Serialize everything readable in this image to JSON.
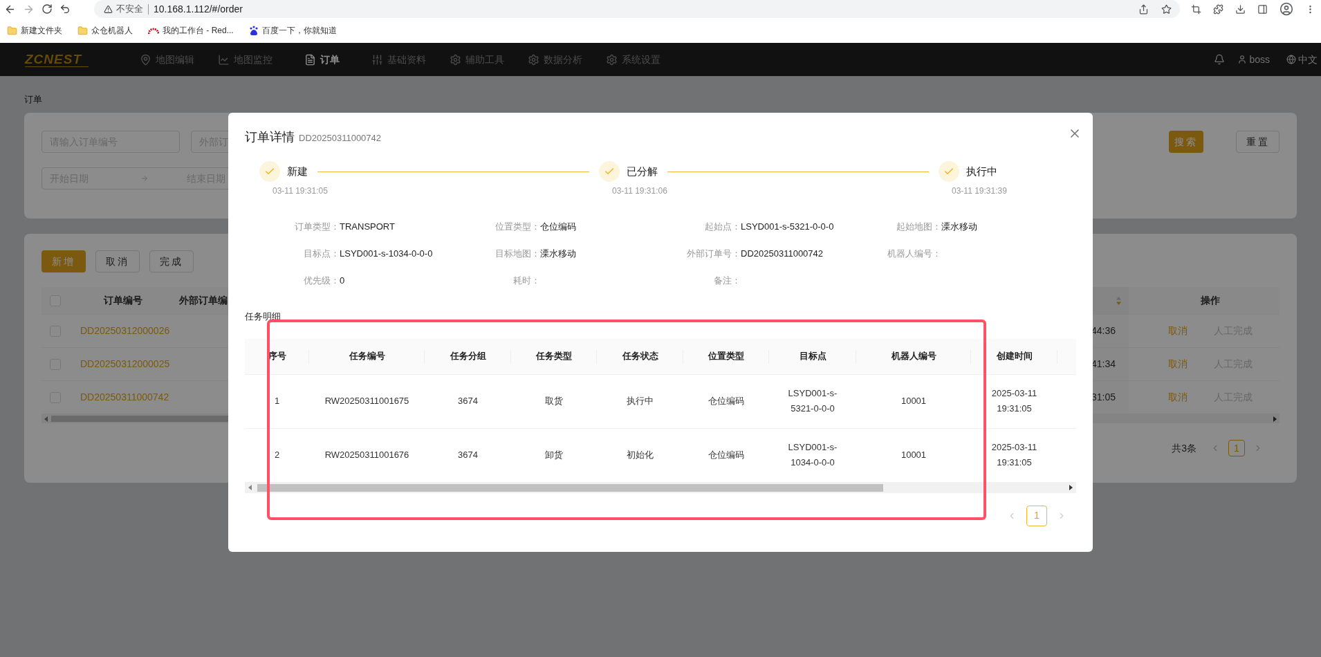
{
  "browser": {
    "warning": "不安全",
    "url": "10.168.1.112/#/order",
    "bookmarks": [
      {
        "label": "新建文件夹",
        "kind": "folder"
      },
      {
        "label": "众仓机器人",
        "kind": "folder"
      },
      {
        "label": "我的工作台 - Red...",
        "kind": "redmine"
      },
      {
        "label": "百度一下，你就知道",
        "kind": "baidu"
      }
    ]
  },
  "nav": {
    "logo": "ZCNEST",
    "items": [
      {
        "label": "地图编辑",
        "selected": false
      },
      {
        "label": "地图监控",
        "selected": false
      },
      {
        "label": "订单",
        "selected": true
      },
      {
        "label": "基础资料",
        "selected": false
      },
      {
        "label": "辅助工具",
        "selected": false
      },
      {
        "label": "数据分析",
        "selected": false
      },
      {
        "label": "系统设置",
        "selected": false
      }
    ],
    "user": "boss",
    "language": "中文"
  },
  "page": {
    "breadcrumb": "订单",
    "filters": [
      {
        "placeholder": "请输入订单编号"
      },
      {
        "placeholder": "外部订"
      }
    ],
    "date_range": {
      "start_placeholder": "开始日期",
      "end_placeholder": "结束日期"
    },
    "search_button": "搜索",
    "reset_button": "重置",
    "actions": [
      {
        "label": "新增",
        "kind": "primary"
      },
      {
        "label": "取消",
        "kind": "default"
      },
      {
        "label": "完成",
        "kind": "default"
      }
    ],
    "table": {
      "header_checked": false,
      "columns": [
        "订单编号",
        "外部订单编"
      ],
      "action_column": "操作",
      "rows": [
        {
          "checked": false,
          "order_no": "DD20250312000026",
          "time": "44:36",
          "actions": [
            "取消",
            "人工完成"
          ]
        },
        {
          "checked": false,
          "order_no": "DD20250312000025",
          "time": "41:34",
          "actions": [
            "取消",
            "人工完成"
          ]
        },
        {
          "checked": false,
          "order_no": "DD20250311000742",
          "time": "31:05",
          "actions": [
            "取消",
            "人工完成"
          ]
        }
      ]
    },
    "pagination": {
      "total": "共3条",
      "pages": [
        {
          "label": "1",
          "selected": true
        }
      ]
    }
  },
  "dialog": {
    "title": "订单详情",
    "subtitle": "DD20250311000742",
    "steps": [
      {
        "title": "新建",
        "time": "03-11 19:31:05",
        "done": true
      },
      {
        "title": "已分解",
        "time": "03-11 19:31:06",
        "done": true
      },
      {
        "title": "执行中",
        "time": "03-11 19:31:39",
        "done": true
      }
    ],
    "details": [
      {
        "label": "订单类型：",
        "value": "TRANSPORT"
      },
      {
        "label": "位置类型：",
        "value": "仓位编码"
      },
      {
        "label": "起始点：",
        "value": "LSYD001-s-5321-0-0-0"
      },
      {
        "label": "起始地图：",
        "value": "溧水移动"
      },
      {
        "label": "目标点：",
        "value": "LSYD001-s-1034-0-0-0"
      },
      {
        "label": "目标地图：",
        "value": "溧水移动"
      },
      {
        "label": "外部订单号：",
        "value": "DD20250311000742"
      },
      {
        "label": "机器人编号："
      },
      {
        "label": "优先级：",
        "value": "0"
      },
      {
        "label": "耗时："
      },
      {
        "label": "备注："
      }
    ],
    "section": "任务明细",
    "table": {
      "columns": [
        "序号",
        "任务编号",
        "任务分组",
        "任务类型",
        "任务状态",
        "位置类型",
        "目标点",
        "机器人编号",
        "创建时间"
      ],
      "rows": [
        {
          "cells": [
            "1",
            "RW20250311001675",
            "3674",
            "取货",
            "执行中",
            "仓位编码",
            "LSYD001-s-5321-0-0-0",
            "10001",
            "2025-03-11 19:31:05"
          ]
        },
        {
          "cells": [
            "2",
            "RW20250311001676",
            "3674",
            "卸货",
            "初始化",
            "仓位编码",
            "LSYD001-s-1034-0-0-0",
            "10001",
            "2025-03-11 19:31:05"
          ]
        }
      ]
    },
    "pagination": {
      "pages": [
        {
          "label": "1",
          "selected": true
        }
      ]
    }
  }
}
